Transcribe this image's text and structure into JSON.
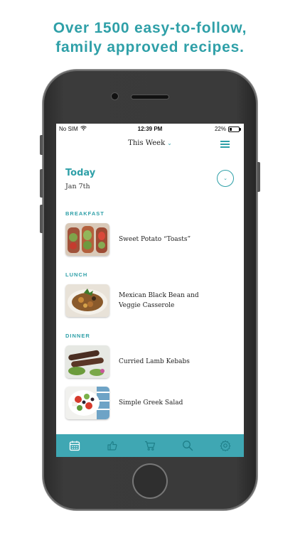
{
  "promo": {
    "line1": "Over 1500 easy-to-follow,",
    "line2": "family approved recipes."
  },
  "status_bar": {
    "carrier": "No SIM",
    "time": "12:39 PM",
    "battery": "22%",
    "battery_level": 0.22
  },
  "header": {
    "week_label": "This Week",
    "chevron": "chevron-down-icon",
    "menu_icon": "hamburger-menu-icon"
  },
  "day": {
    "title": "Today",
    "date": "Jan 7th",
    "expand_icon": "chevron-down-icon"
  },
  "sections": {
    "breakfast": {
      "label": "BREAKFAST",
      "meals": [
        {
          "title": "Sweet Potato “Toasts”"
        }
      ]
    },
    "lunch": {
      "label": "LUNCH",
      "meals": [
        {
          "title": "Mexican Black Bean and Veggie Casserole"
        }
      ]
    },
    "dinner": {
      "label": "DINNER",
      "meals": [
        {
          "title": "Curried Lamb Kebabs"
        },
        {
          "title": "Simple Greek Salad"
        }
      ]
    }
  },
  "tabbar": {
    "tabs": [
      {
        "icon": "calendar-icon",
        "active": true
      },
      {
        "icon": "thumbs-up-icon",
        "active": false
      },
      {
        "icon": "shopping-cart-icon",
        "active": false
      },
      {
        "icon": "search-icon",
        "active": false
      },
      {
        "icon": "gear-icon",
        "active": false
      }
    ],
    "active_color": "#ffffff",
    "inactive_color": "#1f7f89"
  },
  "colors": {
    "accent": "#2fa0a8",
    "tabbar_bg": "#3fa7b3"
  }
}
